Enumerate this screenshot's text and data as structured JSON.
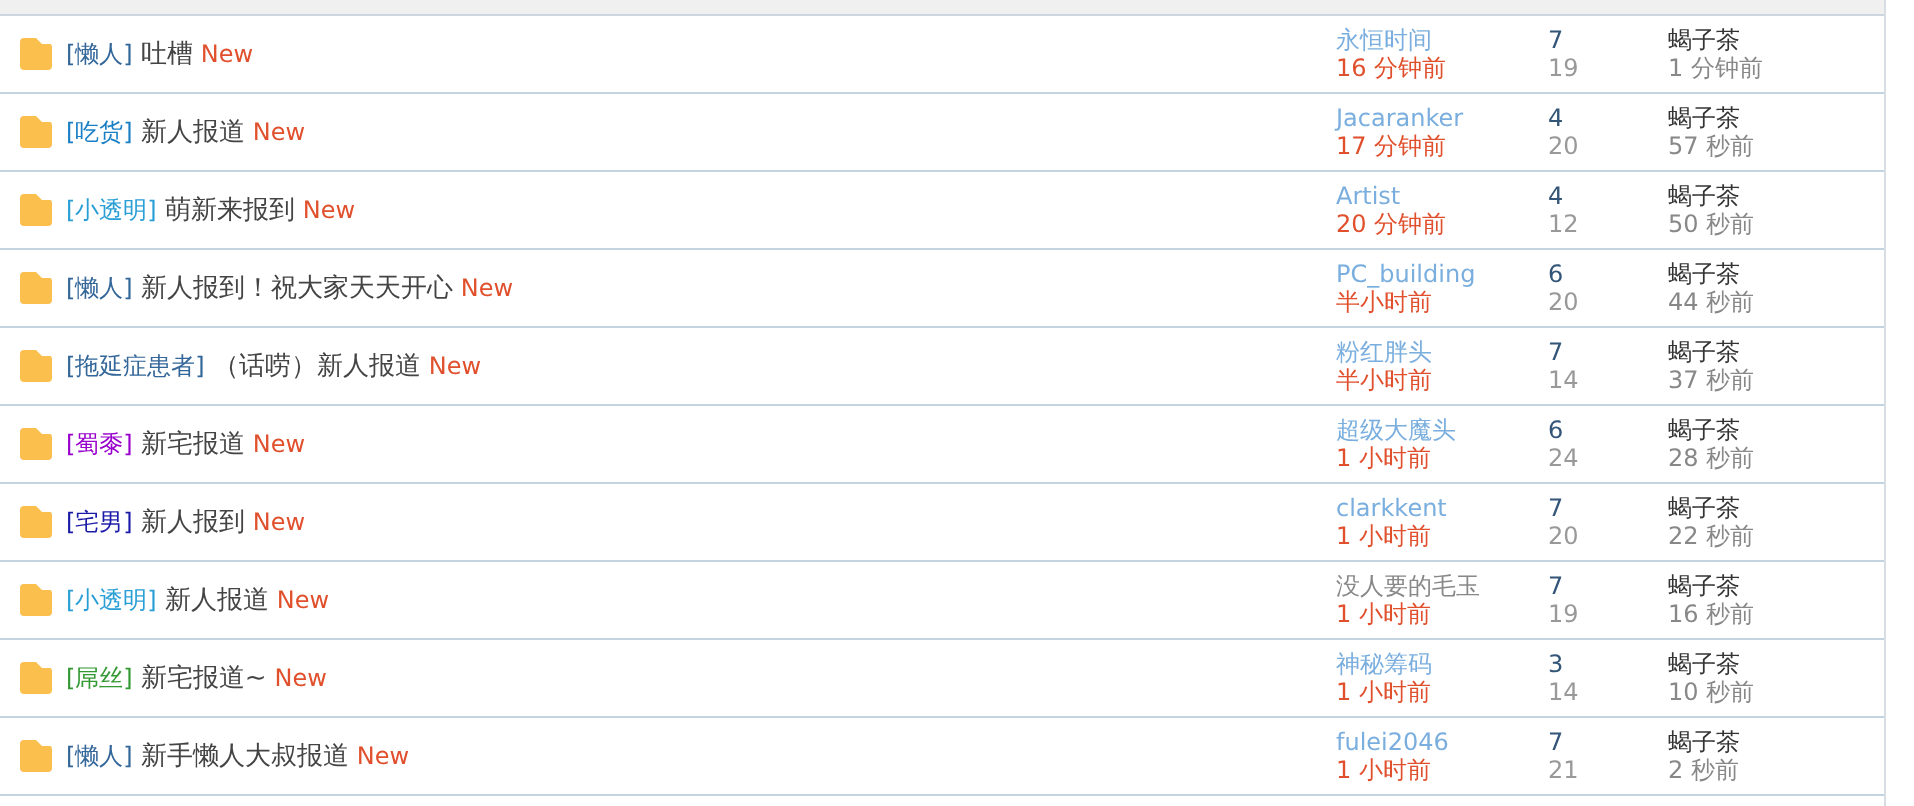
{
  "threads": [
    {
      "tag": {
        "text": "[懒人]",
        "color": "#336699"
      },
      "title": "吐槽",
      "badge": "New",
      "author": {
        "name": "永恒时间",
        "color": "#7aaede"
      },
      "posted": "16 分钟前",
      "replies": "7",
      "views": "19",
      "last_poster": "蝎子茶",
      "last_time": "1 分钟前"
    },
    {
      "tag": {
        "text": "[吃货]",
        "color": "#1a7fc4"
      },
      "title": "新人报道",
      "badge": "New",
      "author": {
        "name": "Jacaranker",
        "color": "#7aaede"
      },
      "posted": "17 分钟前",
      "replies": "4",
      "views": "20",
      "last_poster": "蝎子茶",
      "last_time": "57 秒前"
    },
    {
      "tag": {
        "text": "[小透明]",
        "color": "#2a9fd6"
      },
      "title": "萌新来报到",
      "badge": "New",
      "author": {
        "name": "Artist",
        "color": "#7aaede"
      },
      "posted": "20 分钟前",
      "replies": "4",
      "views": "12",
      "last_poster": "蝎子茶",
      "last_time": "50 秒前"
    },
    {
      "tag": {
        "text": "[懒人]",
        "color": "#336699"
      },
      "title": "新人报到！祝大家天天开心",
      "badge": "New",
      "author": {
        "name": "PC_building",
        "color": "#7aaede"
      },
      "posted": "半小时前",
      "replies": "6",
      "views": "20",
      "last_poster": "蝎子茶",
      "last_time": "44 秒前"
    },
    {
      "tag": {
        "text": "[拖延症患者]",
        "color": "#336699"
      },
      "title": "（话唠）新人报道",
      "badge": "New",
      "author": {
        "name": "粉红胖头",
        "color": "#7aaede"
      },
      "posted": "半小时前",
      "replies": "7",
      "views": "14",
      "last_poster": "蝎子茶",
      "last_time": "37 秒前"
    },
    {
      "tag": {
        "text": "[蜀黍]",
        "color": "#9900cc"
      },
      "title": "新宅报道",
      "badge": "New",
      "author": {
        "name": "超级大魔头",
        "color": "#7aaede"
      },
      "posted": "1 小时前",
      "replies": "6",
      "views": "24",
      "last_poster": "蝎子茶",
      "last_time": "28 秒前"
    },
    {
      "tag": {
        "text": "[宅男]",
        "color": "#1a1aa8"
      },
      "title": "新人报到",
      "badge": "New",
      "author": {
        "name": "clarkkent",
        "color": "#7aaede"
      },
      "posted": "1 小时前",
      "replies": "7",
      "views": "20",
      "last_poster": "蝎子茶",
      "last_time": "22 秒前"
    },
    {
      "tag": {
        "text": "[小透明]",
        "color": "#2a9fd6"
      },
      "title": "新人报道",
      "badge": "New",
      "author": {
        "name": "没人要的毛玉",
        "color": "#888888"
      },
      "posted": "1 小时前",
      "replies": "7",
      "views": "19",
      "last_poster": "蝎子茶",
      "last_time": "16 秒前"
    },
    {
      "tag": {
        "text": "[屌丝]",
        "color": "#339933"
      },
      "title": "新宅报道~",
      "badge": "New",
      "author": {
        "name": "神秘筹码",
        "color": "#7aaede"
      },
      "posted": "1 小时前",
      "replies": "3",
      "views": "14",
      "last_poster": "蝎子茶",
      "last_time": "10 秒前"
    },
    {
      "tag": {
        "text": "[懒人]",
        "color": "#336699"
      },
      "title": "新手懒人大叔报道",
      "badge": "New",
      "author": {
        "name": "fulei2046",
        "color": "#7aaede"
      },
      "posted": "1 小时前",
      "replies": "7",
      "views": "21",
      "last_poster": "蝎子茶",
      "last_time": "2 秒前"
    }
  ]
}
